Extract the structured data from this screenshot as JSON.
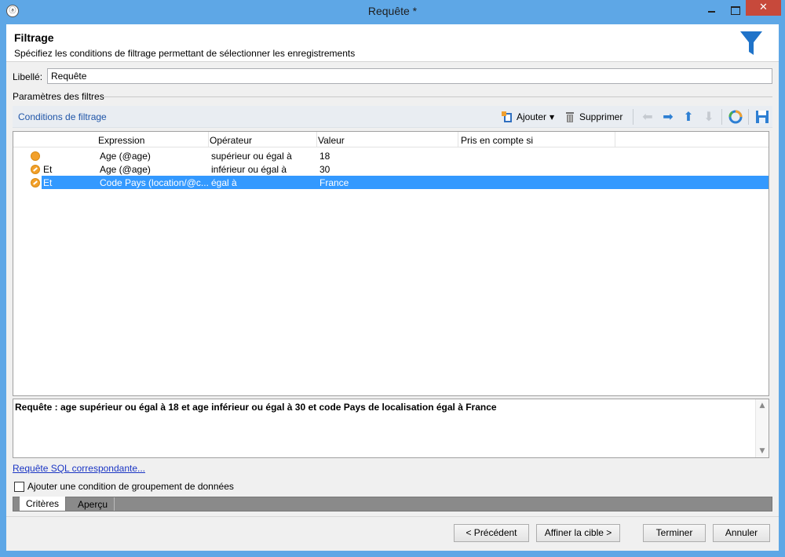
{
  "window": {
    "title": "Requête *",
    "close_glyph": "✕"
  },
  "header": {
    "title": "Filtrage",
    "subtitle": "Spécifiez les conditions de filtrage permettant de sélectionner les enregistrements",
    "icon": "funnel-icon",
    "icon_color": "#1f73c9"
  },
  "libelle": {
    "label": "Libellé:",
    "value": "Requête"
  },
  "group_title": "Paramètres des filtres",
  "toolbar": {
    "tab_label": "Conditions de filtrage",
    "add_label": "Ajouter",
    "delete_label": "Supprimer"
  },
  "grid": {
    "columns": [
      "Expression",
      "Opérateur",
      "Valeur",
      "Pris en compte si"
    ],
    "rows": [
      {
        "connector": "",
        "expression": "Age (@age)",
        "operator": "supérieur ou égal à",
        "value": "18",
        "selected": false
      },
      {
        "connector": "Et",
        "expression": "Age (@age)",
        "operator": "inférieur ou égal à",
        "value": "30",
        "selected": false
      },
      {
        "connector": "Et",
        "expression": "Code Pays (location/@c...",
        "operator": "égal à",
        "value": "France",
        "selected": true
      }
    ]
  },
  "summary": "Requête : age supérieur ou égal à 18 et age inférieur ou égal à 30 et code Pays de localisation égal à France",
  "sql_link": "Requête SQL correspondante...",
  "grouping_checkbox": {
    "label": "Ajouter une condition de groupement de données",
    "checked": false
  },
  "tabs": [
    {
      "label": "Critères",
      "active": true
    },
    {
      "label": "Aperçu",
      "active": false
    }
  ],
  "buttons": {
    "previous": "< Précédent",
    "refine": "Affiner la cible >",
    "finish": "Terminer",
    "cancel": "Annuler"
  },
  "colors": {
    "titlebar": "#5ea7e6",
    "selection": "#3399ff",
    "link": "#1a35c4",
    "condition_dot": "#f2a02a"
  }
}
